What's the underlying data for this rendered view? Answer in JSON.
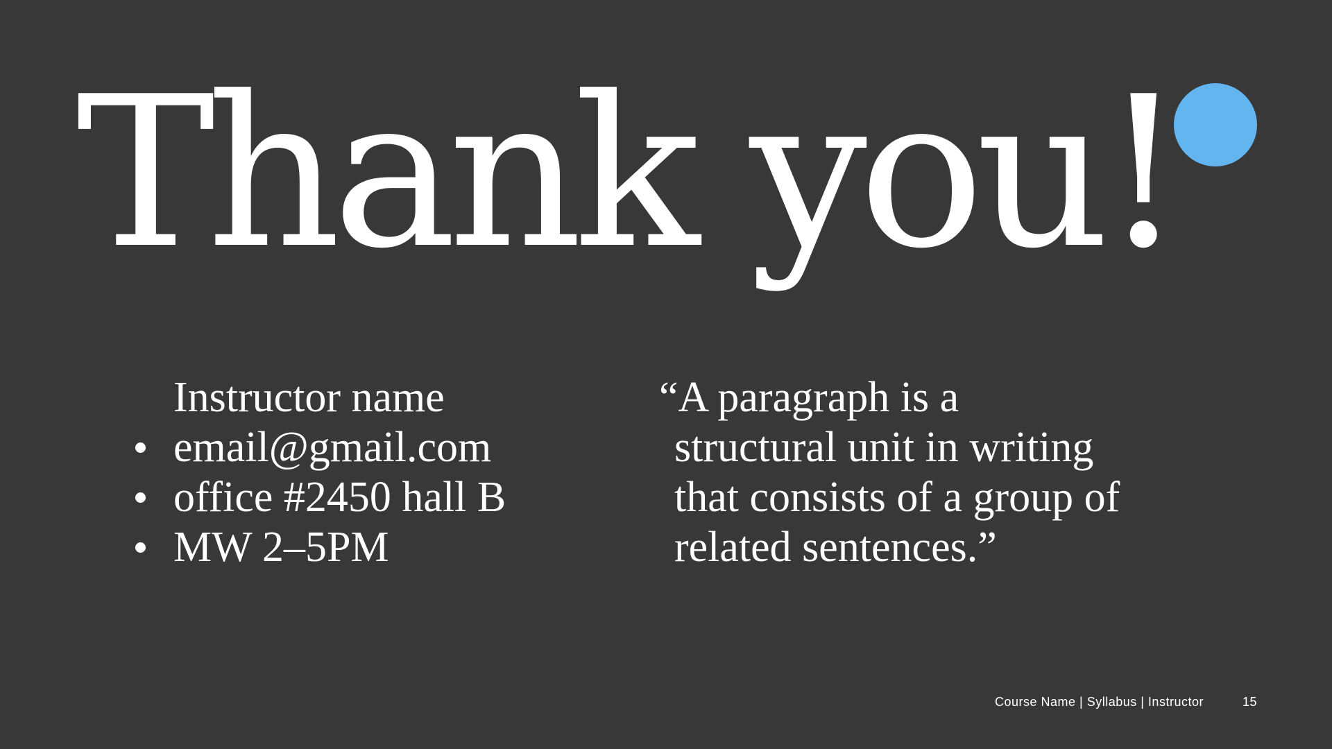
{
  "slide": {
    "title": "Thank you!",
    "accent_color": "#63b5f0",
    "background_color": "#383838"
  },
  "contact": {
    "name": "Instructor name",
    "items": [
      "email@gmail.com",
      "office #2450 hall B",
      "MW 2–5PM"
    ]
  },
  "quote": {
    "lines": [
      "“A paragraph is a",
      "structural unit in writing",
      "that consists of a group of",
      "related sentences.”"
    ]
  },
  "footer": {
    "text": "Course Name | Syllabus | Instructor",
    "page_number": "15"
  }
}
